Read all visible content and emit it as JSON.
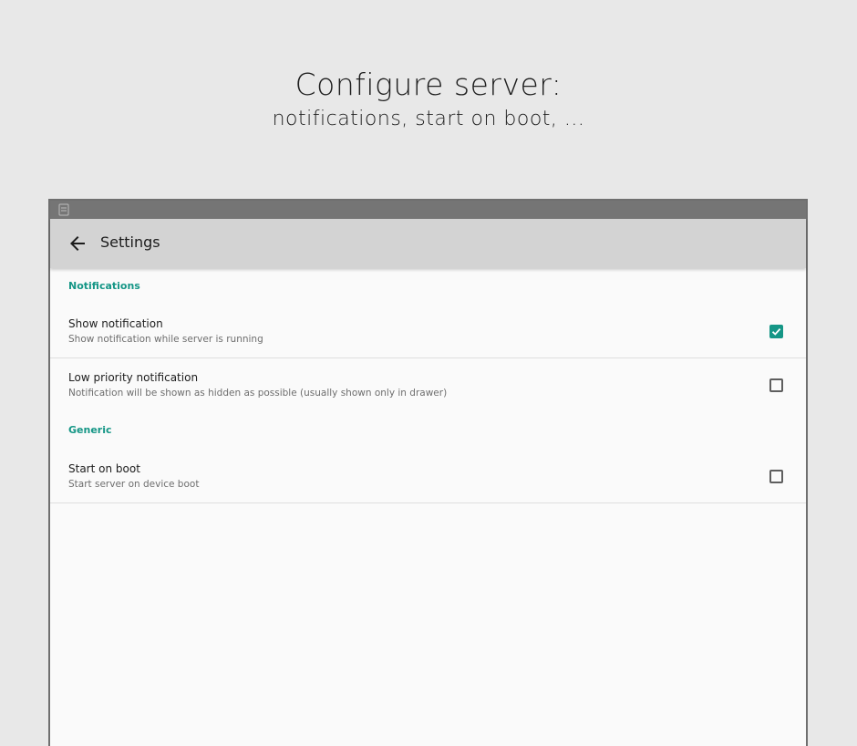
{
  "headline": {
    "title": "Configure server:",
    "subtitle": "notifications, start on boot,  ..."
  },
  "statusbar": {
    "app_icon": "app-icon"
  },
  "appbar": {
    "back_icon": "arrow-left-icon",
    "title": "Settings"
  },
  "sections": {
    "notifications": {
      "header": "Notifications",
      "show_notification": {
        "title": "Show notification",
        "summary": "Show notification while server is running",
        "checked": true
      },
      "low_priority": {
        "title": "Low priority notification",
        "summary": "Notification will be shown as hidden as possible (usually shown only in drawer)",
        "checked": false
      }
    },
    "generic": {
      "header": "Generic",
      "start_on_boot": {
        "title": "Start on boot",
        "summary": "Start server on device boot",
        "checked": false
      }
    }
  },
  "colors": {
    "accent": "#159686",
    "appbar": "#d3d3d3",
    "statusbar": "#757575",
    "background": "#e8e8e8"
  }
}
